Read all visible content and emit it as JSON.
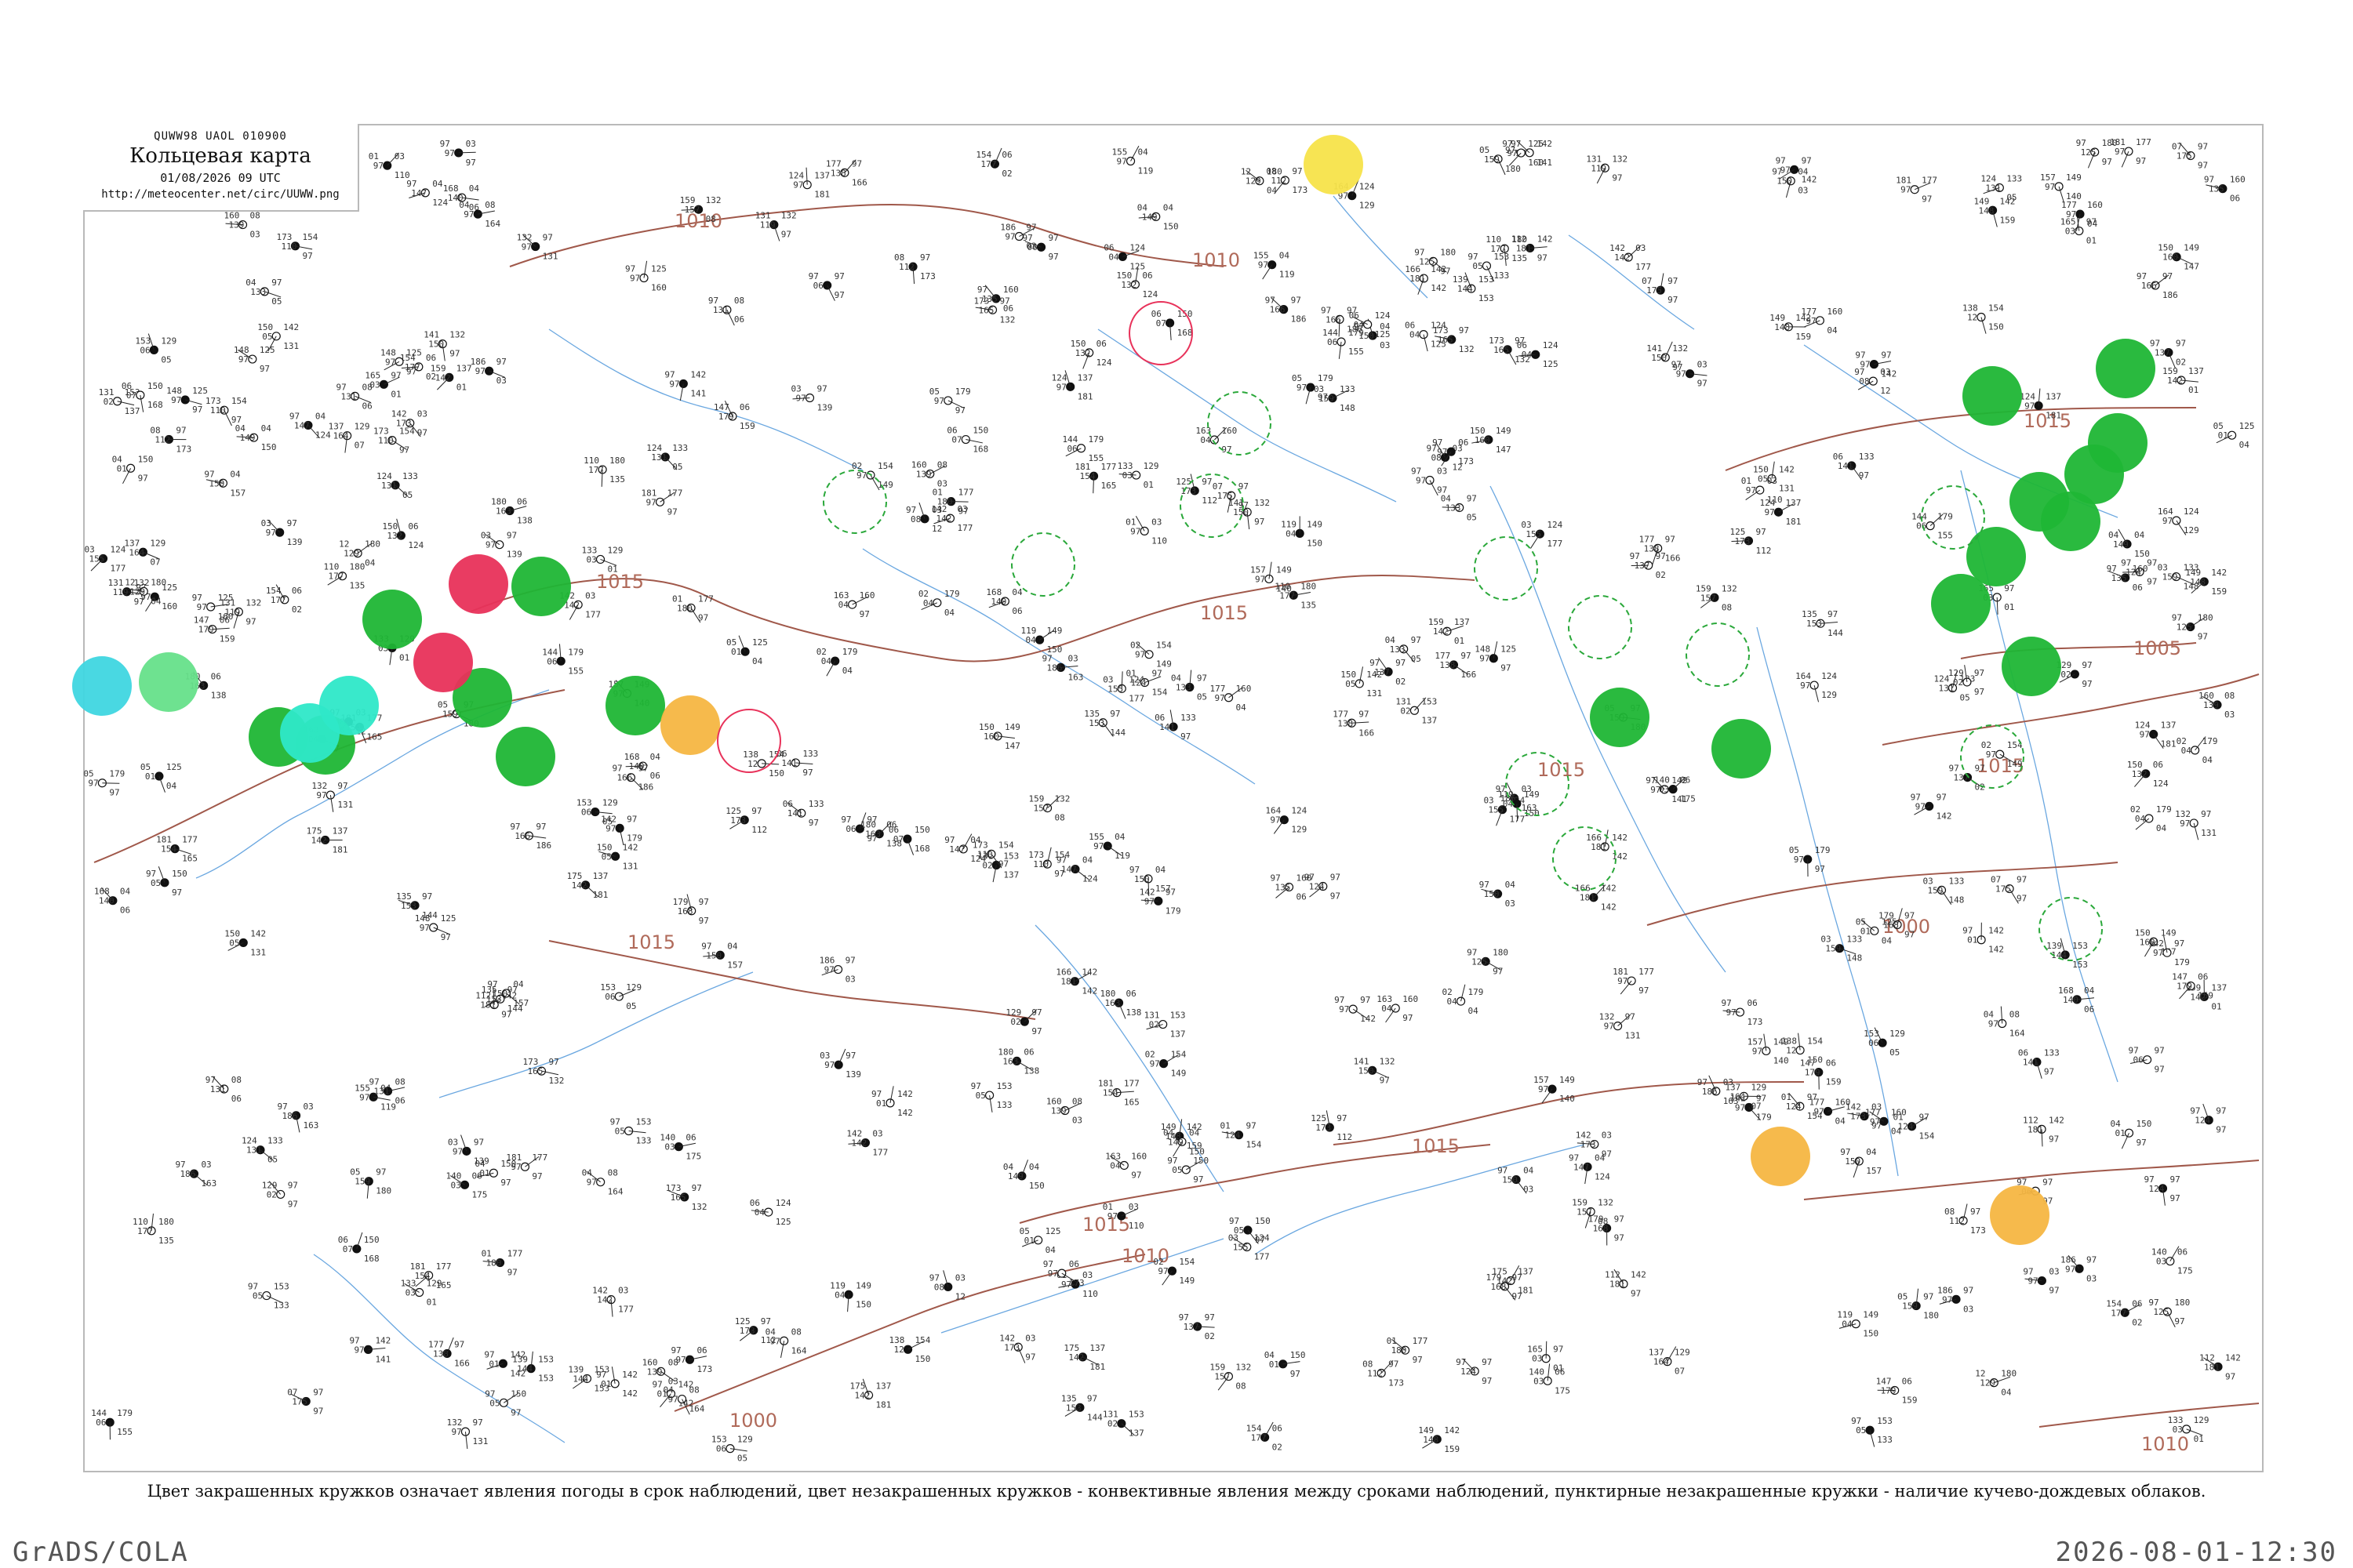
{
  "title_box": {
    "code": "QUWW98 UAOL 010900",
    "title": "Кольцевая карта",
    "date": "01/08/2026 09 UTC",
    "url": "http://meteocenter.net/circ/UUWW.png"
  },
  "caption": "Цвет закрашенных кружков означает явления погоды в срок наблюдений, цвет незакрашенных кружков - конвективные явления между сроками наблюдений, пунктирные незакрашенные кружки - наличие кучево-дождевых облаков.",
  "footer": {
    "left": "GrADS/COLA",
    "right": "2026-08-01-12:30"
  },
  "isobars": [
    "1010",
    "1010",
    "1015",
    "1015",
    "1015",
    "1015",
    "1015",
    "1015",
    "1015",
    "1015",
    "1005",
    "1000",
    "1000",
    "1010",
    "1010"
  ],
  "colors": {
    "rain": "#1fb635",
    "shower_light": "#66e08a",
    "thunder": "#e8325a",
    "drizzle": "#2ee8c8",
    "fog_cyan": "#3fd6e0",
    "haze_orange": "#f5b642",
    "yellow": "#f7e34a",
    "cb_dashed": "#2aa83a",
    "rivers": "#6aa7e0",
    "isobars": "#a0584a",
    "frame": "#b9b9b9"
  },
  "weather_circles": [
    {
      "type": "rain",
      "filled": true
    },
    {
      "type": "rain",
      "filled": true
    },
    {
      "type": "rain",
      "filled": true
    },
    {
      "type": "rain",
      "filled": true
    },
    {
      "type": "rain",
      "filled": true
    },
    {
      "type": "rain",
      "filled": true
    },
    {
      "type": "rain",
      "filled": true
    },
    {
      "type": "rain",
      "filled": true
    },
    {
      "type": "rain",
      "filled": true
    },
    {
      "type": "rain",
      "filled": true
    },
    {
      "type": "rain",
      "filled": true
    },
    {
      "type": "rain",
      "filled": true
    },
    {
      "type": "rain",
      "filled": true
    },
    {
      "type": "rain",
      "filled": true
    },
    {
      "type": "rain",
      "filled": true
    },
    {
      "type": "rain",
      "filled": true
    },
    {
      "type": "rain",
      "filled": true
    },
    {
      "type": "rain",
      "filled": true
    },
    {
      "type": "thunder",
      "filled": true
    },
    {
      "type": "thunder",
      "filled": true
    },
    {
      "type": "drizzle",
      "filled": true
    },
    {
      "type": "drizzle",
      "filled": true
    },
    {
      "type": "fog_cyan",
      "filled": true
    },
    {
      "type": "shower_light",
      "filled": true
    },
    {
      "type": "haze_orange",
      "filled": true
    },
    {
      "type": "haze_orange",
      "filled": true
    },
    {
      "type": "haze_orange",
      "filled": true
    },
    {
      "type": "yellow",
      "filled": true
    },
    {
      "type": "cb",
      "filled": false
    },
    {
      "type": "cb",
      "filled": false
    },
    {
      "type": "cb",
      "filled": false
    },
    {
      "type": "cb",
      "filled": false
    },
    {
      "type": "cb",
      "filled": false
    },
    {
      "type": "cb",
      "filled": false
    },
    {
      "type": "cb",
      "filled": false
    },
    {
      "type": "cb",
      "filled": false
    },
    {
      "type": "cb",
      "filled": false
    },
    {
      "type": "cb",
      "filled": false
    },
    {
      "type": "cb",
      "filled": false
    },
    {
      "type": "cb",
      "filled": false
    },
    {
      "type": "thunder_ring",
      "filled": false
    },
    {
      "type": "thunder_ring",
      "filled": false
    }
  ],
  "station_readings": [
    "97",
    "159",
    "150",
    "110",
    "06",
    "04",
    "181",
    "131",
    "132",
    "157",
    "163",
    "142",
    "97",
    "173",
    "180",
    "97",
    "05",
    "124",
    "140",
    "186",
    "08",
    "144",
    "97",
    "177",
    "01",
    "05",
    "153",
    "175",
    "168",
    "97",
    "04",
    "131",
    "149",
    "97",
    "03",
    "160",
    "181",
    "97",
    "03",
    "119",
    "177",
    "97",
    "135",
    "02",
    "154",
    "97",
    "148",
    "06",
    "147",
    "173",
    "97",
    "02",
    "112",
    "125",
    "97",
    "07",
    "133",
    "124",
    "97",
    "06",
    "155",
    "141",
    "97",
    "12",
    "164",
    "97",
    "01",
    "139",
    "179",
    "150",
    "97",
    "142",
    "04",
    "138",
    "97",
    "165",
    "97",
    "03",
    "150",
    "142",
    "97",
    "05",
    "166",
    "129",
    "97",
    "01",
    "137",
    "159",
    "97",
    "04"
  ]
}
